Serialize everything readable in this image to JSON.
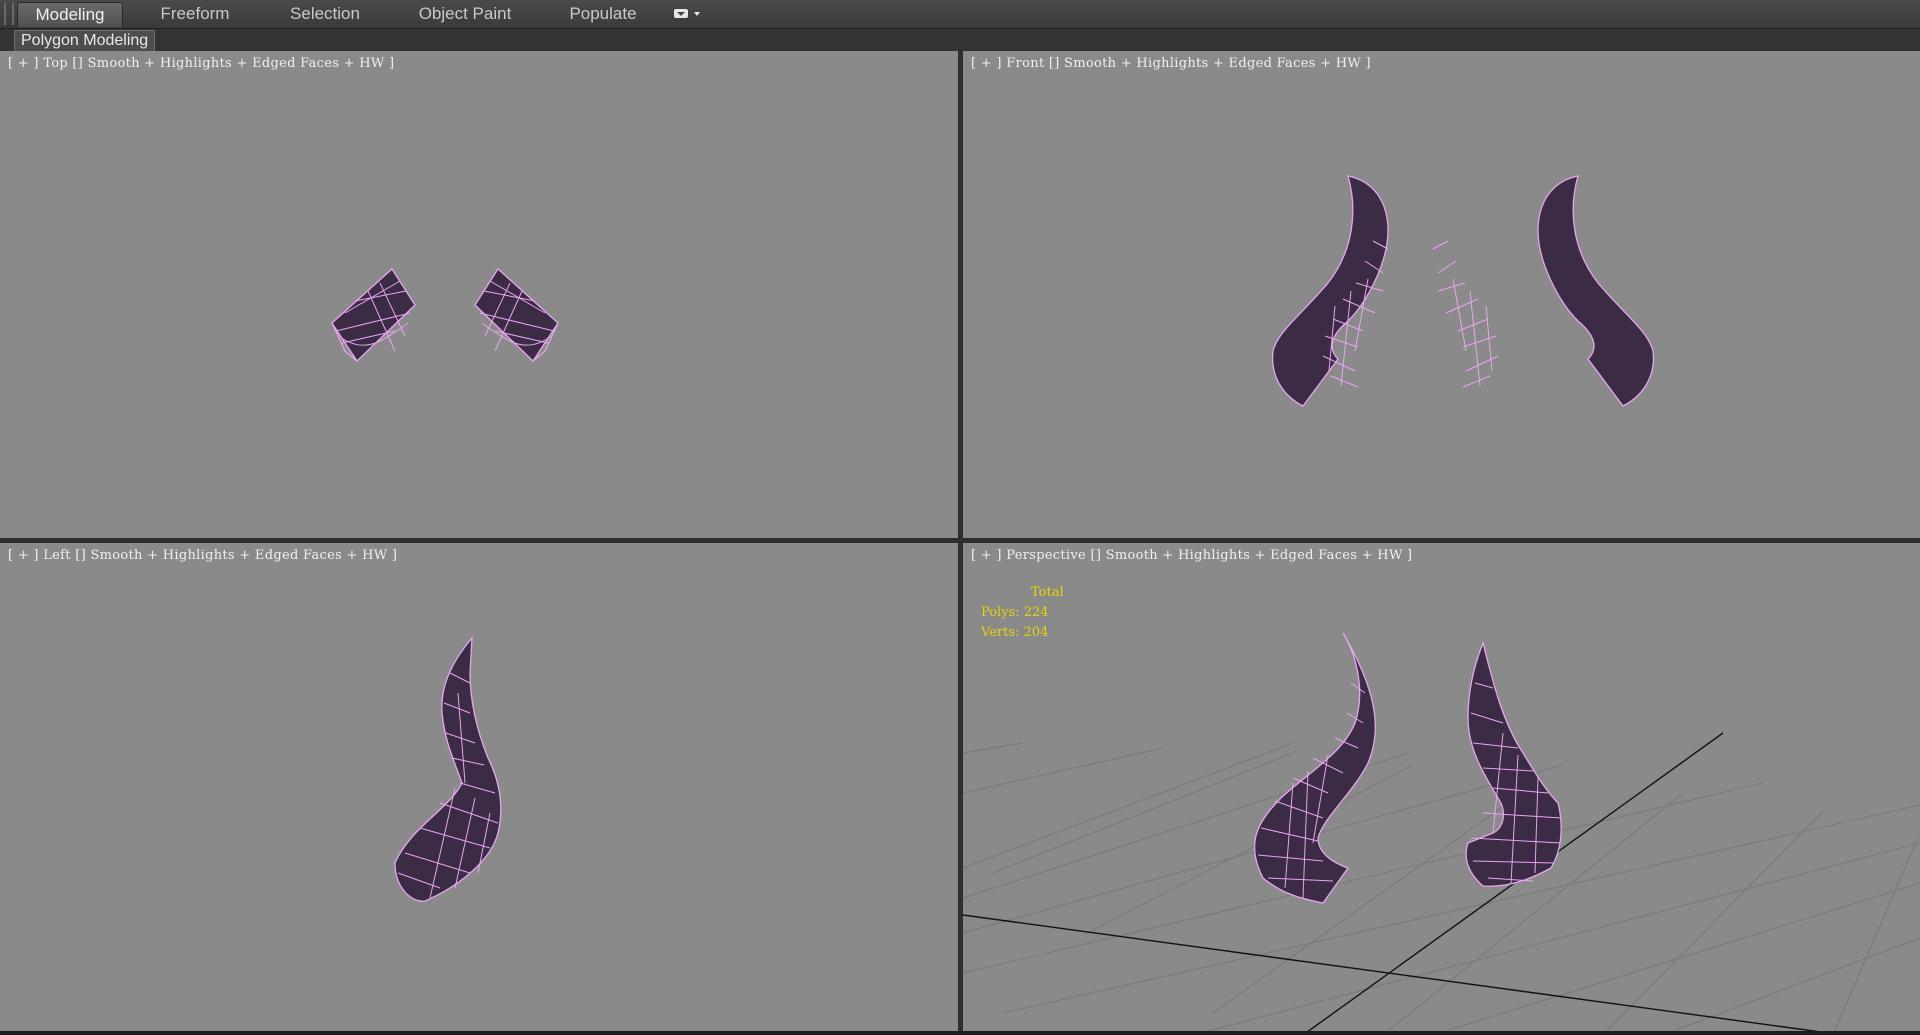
{
  "ribbon": {
    "tabs": [
      {
        "label": "Modeling",
        "active": true
      },
      {
        "label": "Freeform",
        "active": false
      },
      {
        "label": "Selection",
        "active": false
      },
      {
        "label": "Object Paint",
        "active": false
      },
      {
        "label": "Populate",
        "active": false
      }
    ],
    "menu_icon": "ribbon-display-dropdown-icon"
  },
  "subbar": {
    "label": "Polygon Modeling"
  },
  "viewports": {
    "top": {
      "open": "[ + ]",
      "view": "Top",
      "mode": "Smooth + Highlights + Edged Faces + HW",
      "close": "]"
    },
    "front": {
      "open": "[ + ]",
      "view": "Front",
      "mode": "Smooth + Highlights + Edged Faces + HW",
      "close": "]"
    },
    "left": {
      "open": "[ + ]",
      "view": "Left",
      "mode": "Smooth + Highlights + Edged Faces + HW",
      "close": "]"
    },
    "perspective": {
      "open": "[ + ]",
      "view": "Perspective",
      "mode": "Smooth + Highlights + Edged Faces + HW",
      "close": "]"
    }
  },
  "stats": {
    "title": "Total",
    "polys_label": "Polys:",
    "polys": "224",
    "verts_label": "Verts:",
    "verts": "204"
  },
  "colors": {
    "viewport_bg": "#8a8a8a",
    "mesh_fill": "#3c2b45",
    "mesh_edge": "#e8a6ef",
    "stats_text": "#e6d400",
    "grid_line": "#7c7c7c",
    "grid_axis": "#111111"
  }
}
